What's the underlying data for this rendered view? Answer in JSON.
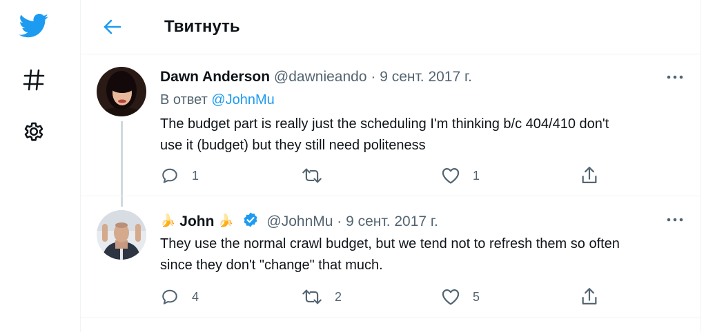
{
  "nav": {
    "items": [
      {
        "name": "twitter-logo-icon"
      },
      {
        "name": "explore-hashtag-icon"
      },
      {
        "name": "settings-gear-icon"
      }
    ]
  },
  "header": {
    "title": "Твитнуть"
  },
  "tweets": [
    {
      "display_name": "Dawn Anderson",
      "handle": "@dawnieando",
      "separator": "·",
      "date": "9 сент. 2017 г.",
      "reply_prefix": "В ответ",
      "reply_to": "@JohnMu",
      "text_line1": "The budget part is really just the scheduling I'm thinking b/c 404/410 don't",
      "text_line2": "use it (budget) but they still need politeness",
      "replies": "1",
      "retweets": "",
      "likes": "1"
    },
    {
      "name_prefix_emoji": "🍌",
      "display_name": "John",
      "name_suffix_emoji": "🍌",
      "verified": true,
      "handle": "@JohnMu",
      "separator": "·",
      "date": "9 сент. 2017 г.",
      "text_line1": "They use the normal crawl budget, but we tend not to refresh them so often",
      "text_line2": "since they don't \"change\" that much.",
      "replies": "4",
      "retweets": "2",
      "likes": "5"
    }
  ],
  "colors": {
    "accent": "#1d9bf0",
    "text": "#0f1419",
    "muted": "#536471",
    "border": "#eff3f4"
  }
}
